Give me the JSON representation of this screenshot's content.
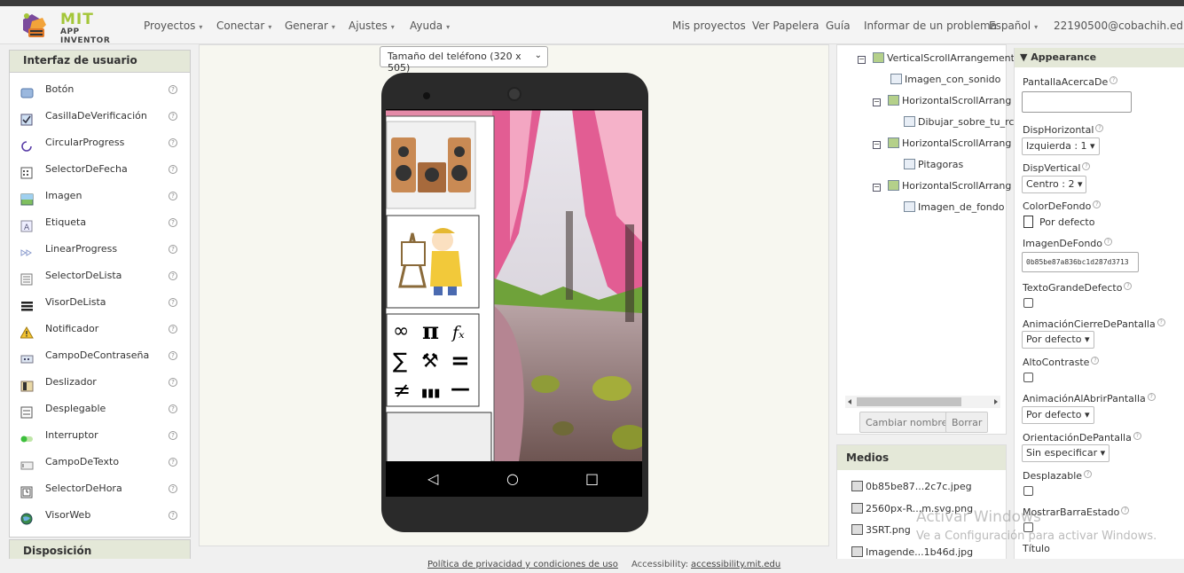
{
  "brand": {
    "title": "MIT",
    "subtitle": "APP INVENTOR"
  },
  "menu": {
    "left": [
      "Proyectos",
      "Conectar",
      "Generar",
      "Ajustes",
      "Ayuda"
    ],
    "right": [
      "Mis proyectos",
      "Ver Papelera",
      "Guía",
      "Informar de un problema",
      "Español",
      "22190500@cobachih.edu.mx"
    ]
  },
  "palette": {
    "title": "Interfaz de usuario",
    "items": [
      "Botón",
      "CasillaDeVerificación",
      "CircularProgress",
      "SelectorDeFecha",
      "Imagen",
      "Etiqueta",
      "LinearProgress",
      "SelectorDeLista",
      "VisorDeLista",
      "Notificador",
      "CampoDeContraseña",
      "Deslizador",
      "Desplegable",
      "Interruptor",
      "CampoDeTexto",
      "SelectorDeHora",
      "VisorWeb"
    ],
    "help_symbol": "?",
    "next_section": "Disposición"
  },
  "viewer": {
    "size_select": "Tamaño del teléfono (320 x 505)"
  },
  "phone": {
    "math_symbols": [
      "∞",
      "π",
      "𝑓ₓ",
      "∑",
      "⚒",
      "=",
      "≠",
      "▮▮▮",
      "—"
    ],
    "nav": {
      "back": "◁",
      "home": "○",
      "recents": "□"
    }
  },
  "tree": {
    "rows": [
      "VerticalScrollArrangement",
      "Imagen_con_sonido",
      "HorizontalScrollArrang",
      "Dibujar_sobre_tu_rc",
      "HorizontalScrollArrang",
      "Pitagoras",
      "HorizontalScrollArrang",
      "Imagen_de_fondo"
    ],
    "collapse_symbol": "−",
    "rename_button": "Cambiar nombre",
    "delete_button": "Borrar"
  },
  "medios": {
    "title": "Medios",
    "files": [
      "0b85be87...2c7c.jpeg",
      "2560px-R...m.svg.png",
      "3SRT.png",
      "Imagende...1b46d.jpg"
    ]
  },
  "properties": {
    "section": "Appearance",
    "pantalla_acerca_label": "PantallaAcercaDe",
    "disp_horizontal_label": "DispHorizontal",
    "disp_horizontal_value": "Izquierda : 1",
    "disp_vertical_label": "DispVertical",
    "disp_vertical_value": "Centro : 2",
    "color_fondo_label": "ColorDeFondo",
    "color_fondo_value": "Por defecto",
    "imagen_fondo_label": "ImagenDeFondo",
    "imagen_fondo_value": "0b85be87a836bc1d287d3713",
    "texto_grande_label": "TextoGrandeDefecto",
    "anim_cierre_label": "AnimaciónCierreDePantalla",
    "anim_cierre_value": "Por defecto",
    "alto_contraste_label": "AltoContraste",
    "anim_abrir_label": "AnimaciónAlAbrirPantalla",
    "anim_abrir_value": "Por defecto",
    "orientacion_label": "OrientaciónDePantalla",
    "orientacion_value": "Sin especificar",
    "desplazable_label": "Desplazable",
    "barra_estado_label": "MostrarBarraEstado",
    "titulo_label": "Título",
    "help_symbol": "?",
    "dropdown_caret": "▾"
  },
  "watermark": {
    "line1": "Activar Windows",
    "line2": "Ve a Configuración para activar Windows."
  },
  "footer": {
    "privacy": "Política de privacidad y condiciones de uso",
    "accessibility_label": "Accessibility:",
    "accessibility_link": "accessibility.mit.edu"
  }
}
